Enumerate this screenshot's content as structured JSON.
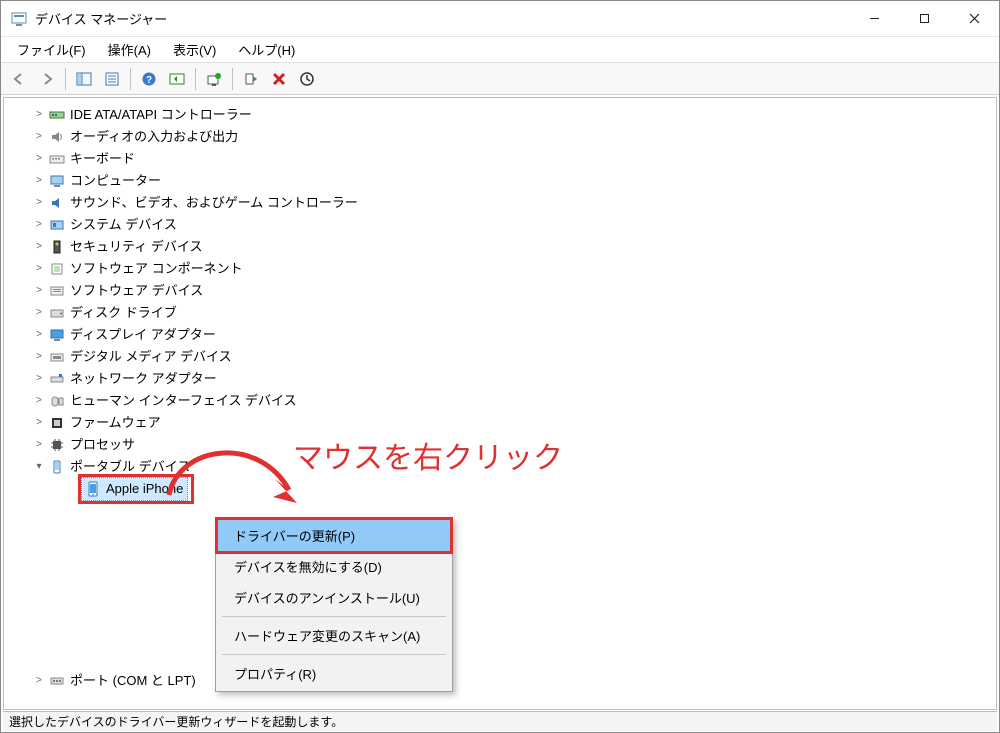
{
  "window": {
    "title": "デバイス マネージャー"
  },
  "menubar": {
    "items": [
      {
        "label": "ファイル(F)"
      },
      {
        "label": "操作(A)"
      },
      {
        "label": "表示(V)"
      },
      {
        "label": "ヘルプ(H)"
      }
    ]
  },
  "toolbar": {
    "buttons": [
      {
        "name": "back-icon"
      },
      {
        "name": "forward-icon"
      },
      {
        "name": "sep"
      },
      {
        "name": "show-hide-tree-icon"
      },
      {
        "name": "properties-icon"
      },
      {
        "name": "sep"
      },
      {
        "name": "help-icon"
      },
      {
        "name": "action-icon"
      },
      {
        "name": "sep"
      },
      {
        "name": "update-driver-icon"
      },
      {
        "name": "sep"
      },
      {
        "name": "uninstall-device-green-icon"
      },
      {
        "name": "uninstall-device-red-icon"
      },
      {
        "name": "scan-hardware-icon"
      }
    ]
  },
  "tree": {
    "items": [
      {
        "label": "IDE ATA/ATAPI コントローラー",
        "icon": "ide-controller-icon"
      },
      {
        "label": "オーディオの入力および出力",
        "icon": "audio-icon"
      },
      {
        "label": "キーボード",
        "icon": "keyboard-icon"
      },
      {
        "label": "コンピューター",
        "icon": "computer-icon"
      },
      {
        "label": "サウンド、ビデオ、およびゲーム コントローラー",
        "icon": "sound-icon"
      },
      {
        "label": "システム デバイス",
        "icon": "system-device-icon"
      },
      {
        "label": "セキュリティ デバイス",
        "icon": "security-device-icon"
      },
      {
        "label": "ソフトウェア コンポーネント",
        "icon": "software-component-icon"
      },
      {
        "label": "ソフトウェア デバイス",
        "icon": "software-device-icon"
      },
      {
        "label": "ディスク ドライブ",
        "icon": "disk-drive-icon"
      },
      {
        "label": "ディスプレイ アダプター",
        "icon": "display-adapter-icon"
      },
      {
        "label": "デジタル メディア デバイス",
        "icon": "digital-media-icon"
      },
      {
        "label": "ネットワーク アダプター",
        "icon": "network-adapter-icon"
      },
      {
        "label": "ヒューマン インターフェイス デバイス",
        "icon": "hid-icon"
      },
      {
        "label": "ファームウェア",
        "icon": "firmware-icon"
      },
      {
        "label": "プロセッサ",
        "icon": "processor-icon"
      },
      {
        "label": "ポータブル デバイス",
        "icon": "portable-device-icon",
        "expanded": true,
        "children": [
          {
            "label": "Apple iPhone",
            "icon": "phone-icon",
            "selected": true
          }
        ]
      },
      {
        "label": "ポート (COM と LPT)",
        "icon": "port-icon",
        "cut": true
      }
    ]
  },
  "context_menu": {
    "items": [
      {
        "label": "ドライバーの更新(P)",
        "highlighted": true
      },
      {
        "label": "デバイスを無効にする(D)"
      },
      {
        "label": "デバイスのアンインストール(U)"
      },
      {
        "sep": true
      },
      {
        "label": "ハードウェア変更のスキャン(A)"
      },
      {
        "sep": true
      },
      {
        "label": "プロパティ(R)"
      }
    ]
  },
  "annotation": {
    "text": "マウスを右クリック"
  },
  "statusbar": {
    "text": "選択したデバイスのドライバー更新ウィザードを起動します。"
  }
}
